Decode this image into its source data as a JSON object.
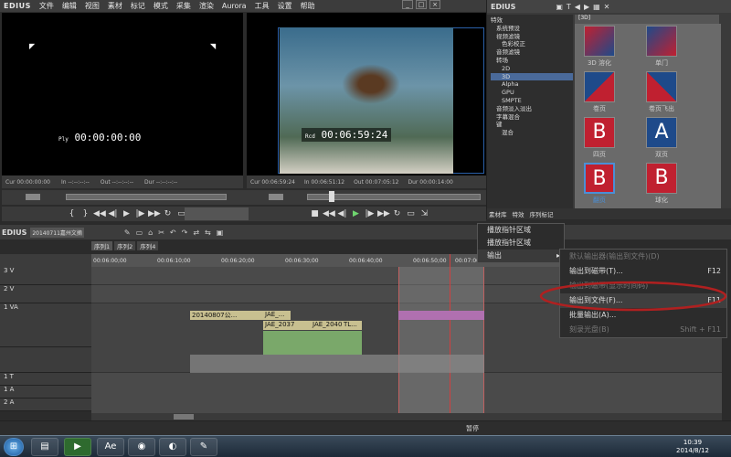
{
  "app": {
    "name": "EDIUS"
  },
  "menu": [
    "文件",
    "编辑",
    "视图",
    "素材",
    "标记",
    "模式",
    "采集",
    "渲染",
    "Aurora",
    "工具",
    "设置",
    "帮助"
  ],
  "player": {
    "timecode": "00:00:00:00",
    "tc_prefix": "Ply",
    "cur": "Cur 00:00:00:00",
    "in": "In --:--:--:--",
    "out": "Out --:--:--:--",
    "dur": "Dur --:--:--:--"
  },
  "recorder": {
    "timecode": "00:06:59:24",
    "tc_prefix": "Rcd",
    "cur": "Cur 00:06:59:24",
    "in": "In 00:06:51:12",
    "out": "Out 00:07:05:12",
    "dur": "Dur 00:00:14:00"
  },
  "effects": {
    "title": "特效",
    "tree": [
      "特效",
      "系统预设",
      "视频滤镜",
      "色彩校正",
      "音频滤镜",
      "转场",
      "2D",
      "3D",
      "Alpha",
      "GPU",
      "SMPTE",
      "音频淡入淡出",
      "字幕混合",
      "键",
      "混合"
    ],
    "tabs": [
      "素材库",
      "特效",
      "序列标记"
    ],
    "folder": "[3D]",
    "thumbnails": [
      "3D 溶化",
      "单门",
      "卷页",
      "卷页飞出",
      "四页",
      "双页",
      "翻页",
      "球化"
    ]
  },
  "timeline": {
    "project": "20140711嘉州文摘",
    "tabs": [
      "序列1",
      "序列2",
      "序列4"
    ],
    "ruler": [
      "00:06:00;00",
      "00:06:10;00",
      "00:06:20;00",
      "00:06:30;00",
      "00:06:40;00",
      "00:06:50;00",
      "00:07:00;00"
    ],
    "tracks": [
      "3 V",
      "2 V",
      "1 VA",
      "",
      "1 T",
      "1 A",
      "2 A"
    ],
    "clips": [
      "20140807公...",
      "JAE_...",
      "JAE_2037",
      "JAE_2040",
      "TL..."
    ],
    "status": "暂停"
  },
  "context_menu_1": {
    "items": [
      "播放指针区域",
      "播放指针区域",
      "输出"
    ]
  },
  "context_menu_2": {
    "items": [
      {
        "label": "默认输出器(输出到文件)(D)",
        "shortcut": "",
        "disabled": true
      },
      {
        "label": "输出到磁带(T)...",
        "shortcut": "F12",
        "disabled": false
      },
      {
        "label": "输出到磁带(显示时间码)",
        "shortcut": "",
        "disabled": true
      },
      {
        "label": "输出到文件(F)...",
        "shortcut": "F11",
        "disabled": false
      },
      {
        "label": "批量输出(A)...",
        "shortcut": "",
        "disabled": false
      },
      {
        "label": "刻录光盘(B)",
        "shortcut": "Shift + F11",
        "disabled": true
      }
    ]
  },
  "taskbar": {
    "time": "10:39",
    "date": "2014/8/12"
  },
  "colors": {
    "bg": "#2b2b2b",
    "accent": "#4a8fd6",
    "highlight_red": "#b02020",
    "clip_yellow": "#c8c090",
    "clip_green": "#7aa86a",
    "range": "#8a8a8a"
  }
}
